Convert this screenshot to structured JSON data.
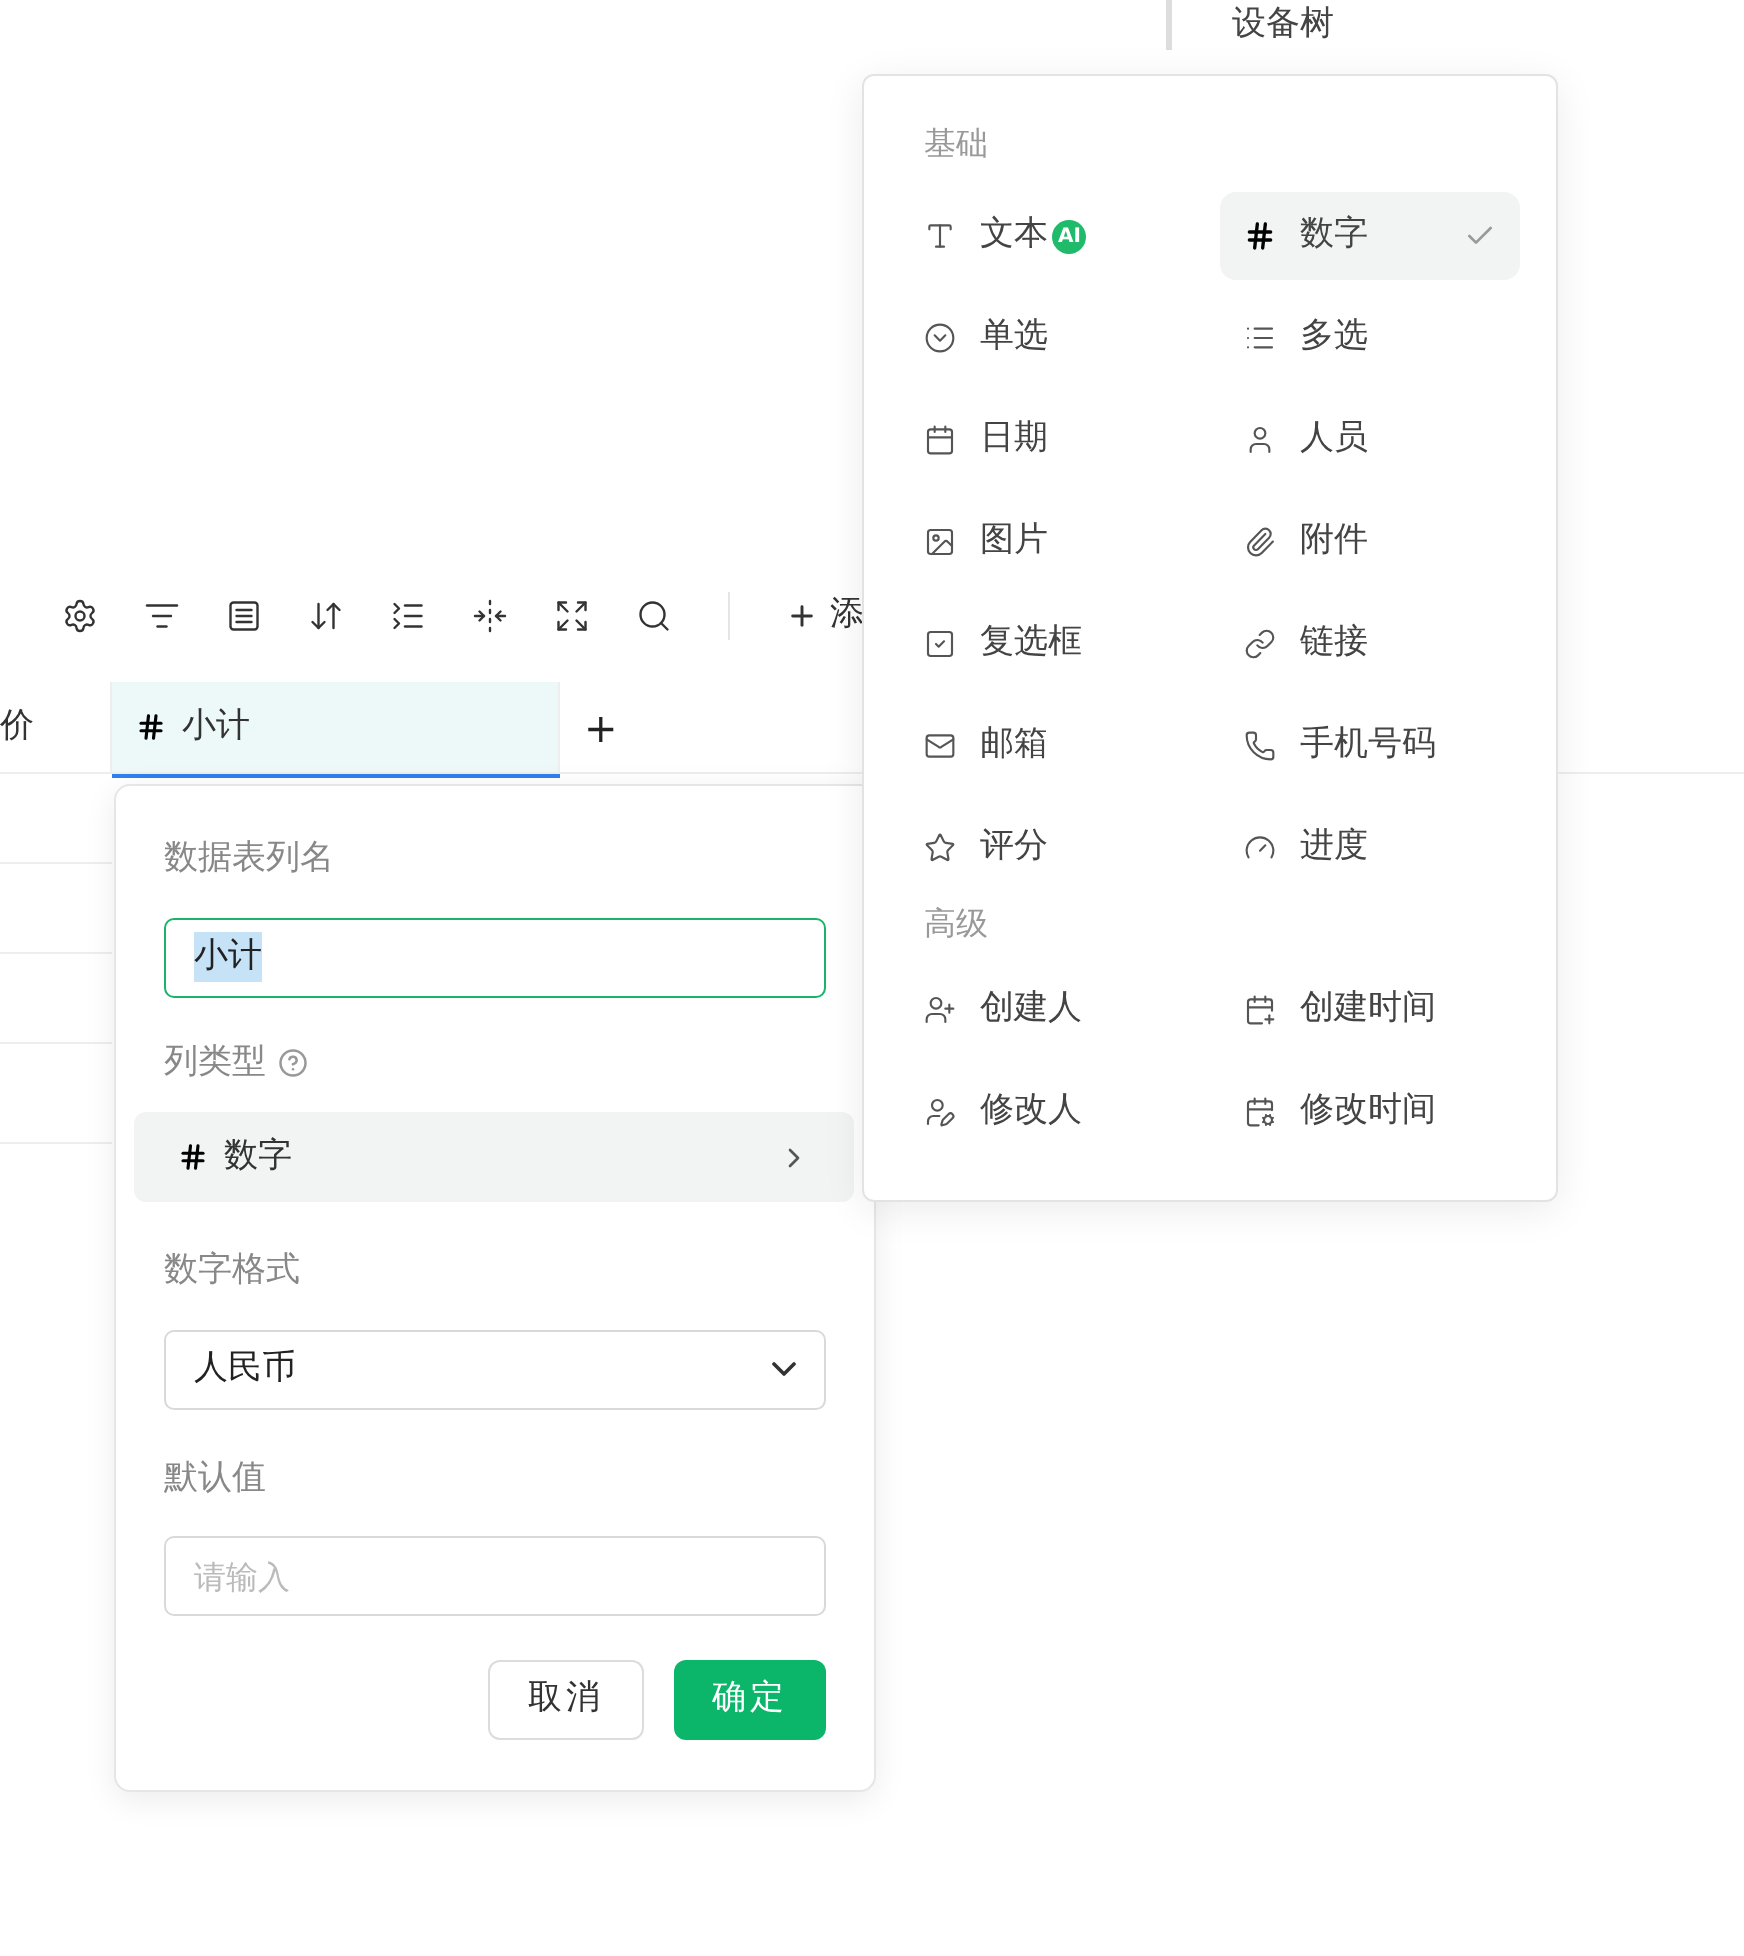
{
  "top_label": "设备树",
  "toolbar": {
    "tools": [
      {
        "kind": "settings"
      },
      {
        "kind": "filter"
      },
      {
        "kind": "form"
      },
      {
        "kind": "sort"
      },
      {
        "kind": "rowheight"
      },
      {
        "kind": "collapse"
      },
      {
        "kind": "fullscreen"
      },
      {
        "kind": "search"
      }
    ],
    "add_label": "添"
  },
  "table": {
    "columns": [
      {
        "label": "价",
        "kind": "text",
        "selected": false
      },
      {
        "label": "小计",
        "kind": "number",
        "selected": true
      }
    ],
    "add_column": "+"
  },
  "field_editor": {
    "name_label": "数据表列名",
    "name_value": "小计",
    "name_value_highlighted": true,
    "type_label": "列类型",
    "type_value": "数字",
    "format_label": "数字格式",
    "format_value": "人民币",
    "default_label": "默认值",
    "default_placeholder": "请输入",
    "buttons": [
      {
        "label": "取消",
        "kind": "secondary"
      },
      {
        "label": "确定",
        "kind": "primary"
      }
    ]
  },
  "type_menu": {
    "sections": [
      {
        "title": "基础",
        "items": [
          {
            "label": "文本",
            "kind": "text",
            "badge": "AI",
            "selected": false
          },
          {
            "label": "数字",
            "kind": "number",
            "selected": true
          },
          {
            "label": "单选",
            "kind": "single",
            "selected": false
          },
          {
            "label": "多选",
            "kind": "multi",
            "selected": false
          },
          {
            "label": "日期",
            "kind": "date",
            "selected": false
          },
          {
            "label": "人员",
            "kind": "person",
            "selected": false
          },
          {
            "label": "图片",
            "kind": "image",
            "selected": false
          },
          {
            "label": "附件",
            "kind": "attach",
            "selected": false
          },
          {
            "label": "复选框",
            "kind": "checkbox",
            "selected": false
          },
          {
            "label": "链接",
            "kind": "link",
            "selected": false
          },
          {
            "label": "邮箱",
            "kind": "mail",
            "selected": false
          },
          {
            "label": "手机号码",
            "kind": "phone",
            "selected": false
          },
          {
            "label": "评分",
            "kind": "star",
            "selected": false
          },
          {
            "label": "进度",
            "kind": "progress",
            "selected": false
          }
        ]
      },
      {
        "title": "高级",
        "items": [
          {
            "label": "创建人",
            "kind": "creator",
            "selected": false
          },
          {
            "label": "创建时间",
            "kind": "created",
            "selected": false
          },
          {
            "label": "修改人",
            "kind": "modifier",
            "selected": false
          },
          {
            "label": "修改时间",
            "kind": "modified",
            "selected": false
          }
        ]
      }
    ]
  }
}
